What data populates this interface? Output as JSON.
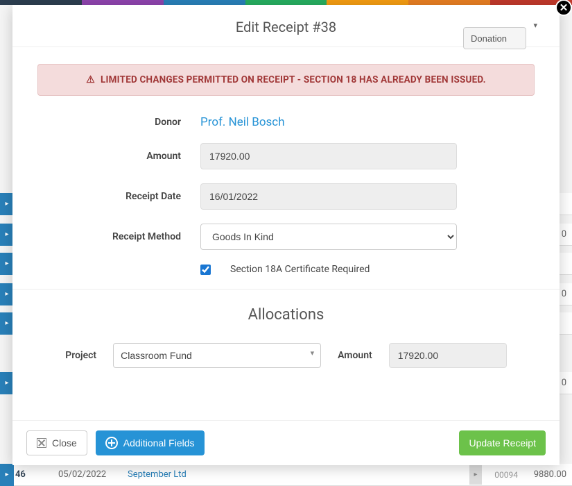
{
  "modal": {
    "title": "Edit Receipt #38",
    "type_select": "Donation",
    "warning_text": "LIMITED CHANGES PERMITTED ON RECEIPT - SECTION 18 HAS ALREADY BEEN ISSUED."
  },
  "form": {
    "donor_label": "Donor",
    "donor_name": "Prof. Neil Bosch",
    "amount_label": "Amount",
    "amount_value": "17920.00",
    "date_label": "Receipt Date",
    "date_value": "16/01/2022",
    "method_label": "Receipt Method",
    "method_value": "Goods In Kind",
    "s18a_checked": true,
    "s18a_label": "Section 18A Certificate Required"
  },
  "allocations": {
    "heading": "Allocations",
    "project_label": "Project",
    "project_value": "Classroom Fund",
    "amount_label": "Amount",
    "amount_value": "17920.00"
  },
  "footer": {
    "close_label": "Close",
    "additional_label": "Additional Fields",
    "update_label": "Update Receipt"
  },
  "bg": {
    "row1": {
      "date": "05/02/2022",
      "name": "September Ltd",
      "code": "00094",
      "amt": "9880.00",
      "num": "46"
    }
  }
}
